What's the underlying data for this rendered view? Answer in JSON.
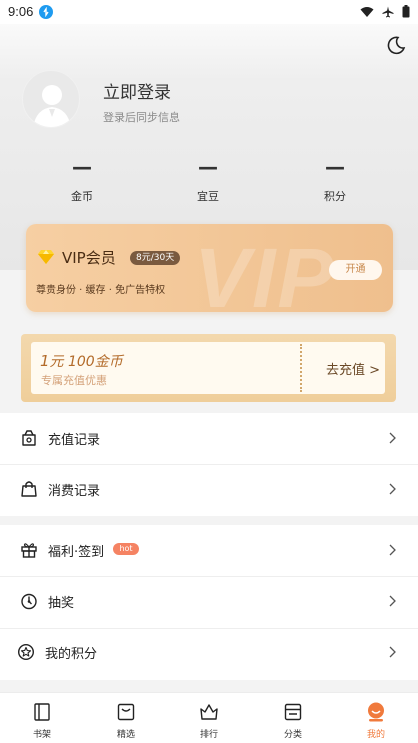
{
  "status_bar": {
    "time": "9:06"
  },
  "profile": {
    "title": "立即登录",
    "subtitle": "登录后同步信息"
  },
  "stats": [
    {
      "value": "—",
      "label": "金币"
    },
    {
      "value": "—",
      "label": "宜豆"
    },
    {
      "value": "—",
      "label": "积分"
    }
  ],
  "vip": {
    "title": "VIP会员",
    "price": "8元/30天",
    "desc": "尊贵身份 · 缓存 · 免广告特权",
    "open_label": "开通",
    "watermark": "VIP"
  },
  "recharge": {
    "main_prefix": "1",
    "main_text": "元 100金币",
    "sub": "专属充值优惠",
    "go_label": "去充值 >"
  },
  "menu": {
    "group1": [
      {
        "label": "充值记录",
        "icon": "wallet-icon"
      },
      {
        "label": "消费记录",
        "icon": "shopping-bag-icon"
      }
    ],
    "group2": [
      {
        "label": "福利·签到",
        "icon": "gift-icon",
        "badge": "hot"
      },
      {
        "label": "抽奖",
        "icon": "lottery-icon"
      },
      {
        "label": "我的积分",
        "icon": "points-icon"
      }
    ]
  },
  "tabs": [
    {
      "label": "书架",
      "icon": "bookshelf-icon",
      "active": false
    },
    {
      "label": "精选",
      "icon": "featured-icon",
      "active": false
    },
    {
      "label": "排行",
      "icon": "ranking-icon",
      "active": false
    },
    {
      "label": "分类",
      "icon": "category-icon",
      "active": false
    },
    {
      "label": "我的",
      "icon": "profile-icon",
      "active": true
    }
  ],
  "colors": {
    "accent": "#f07a3c",
    "vip_gold": "#efbf8d",
    "hot": "#f58363"
  }
}
